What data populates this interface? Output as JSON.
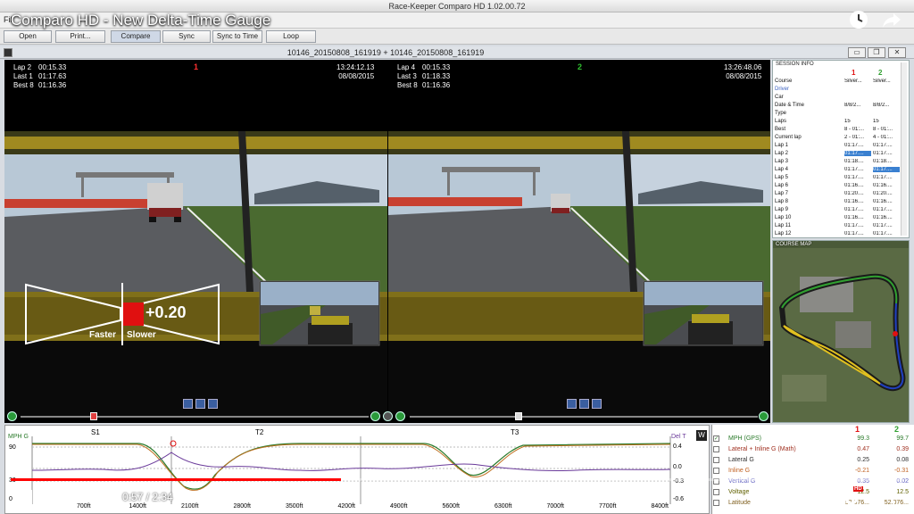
{
  "app": {
    "title": "Race-Keeper Comparo HD 1.02.00.72",
    "menu": [
      "Fil"
    ],
    "toolbar": [
      "Open",
      "Print...",
      "Compare",
      "Sync",
      "Sync to Time",
      "Loop"
    ]
  },
  "youtube": {
    "video_title": "Comparo HD - New Delta-Time Gauge",
    "current_time": "0:57",
    "total_time": "2:34",
    "progress": 0.37,
    "hd_badge": "HD"
  },
  "session": {
    "title": "10146_20150808_161919 + 10146_20150808_161919"
  },
  "video1": {
    "marker": "1",
    "rows": [
      {
        "label": "Lap 2",
        "value": "00:15.33"
      },
      {
        "label": "Last 1",
        "value": "01:17.63"
      },
      {
        "label": "Best 8",
        "value": "01:16.36"
      }
    ],
    "clock": "13:24:12.13",
    "date": "08/08/2015"
  },
  "video2": {
    "marker": "2",
    "rows": [
      {
        "label": "Lap 4",
        "value": "00:15.33"
      },
      {
        "label": "Last 3",
        "value": "01:18.33"
      },
      {
        "label": "Best 8",
        "value": "01:16.36"
      }
    ],
    "clock": "13:26:48.06",
    "date": "08/08/2015"
  },
  "gauge": {
    "delta": "+0.20",
    "faster_label": "Faster",
    "slower_label": "Slower"
  },
  "session_info": {
    "title": "SESSION INFO",
    "col1": "1",
    "col2": "2",
    "rows": [
      {
        "label": "Course",
        "v1": "Silver...",
        "v2": "Silver..."
      },
      {
        "label": "Driver",
        "v1": "",
        "v2": ""
      },
      {
        "label": "Car",
        "v1": "",
        "v2": ""
      },
      {
        "label": "Date & Time",
        "v1": "8/8/2...",
        "v2": "8/8/2..."
      },
      {
        "label": "Type",
        "v1": "",
        "v2": ""
      },
      {
        "label": "Laps",
        "v1": "15",
        "v2": "15"
      },
      {
        "label": "Best",
        "v1": "8 - 01:...",
        "v2": "8 - 01:..."
      },
      {
        "label": "Current lap",
        "v1": "2 - 01:...",
        "v2": "4 - 01:..."
      },
      {
        "label": "Lap 1",
        "v1": "01:17....",
        "v2": "01:17...."
      },
      {
        "label": "Lap 2",
        "v1": "01:17....",
        "v2": "01:17...."
      },
      {
        "label": "Lap 3",
        "v1": "01:18....",
        "v2": "01:18...."
      },
      {
        "label": "Lap 4",
        "v1": "01:17....",
        "v2": "01:17...."
      },
      {
        "label": "Lap 5",
        "v1": "01:17....",
        "v2": "01:17...."
      },
      {
        "label": "Lap 6",
        "v1": "01:16....",
        "v2": "01:16...."
      },
      {
        "label": "Lap 7",
        "v1": "01:20....",
        "v2": "01:20...."
      },
      {
        "label": "Lap 8",
        "v1": "01:16....",
        "v2": "01:16...."
      },
      {
        "label": "Lap 9",
        "v1": "01:17....",
        "v2": "01:17...."
      },
      {
        "label": "Lap 10",
        "v1": "01:16....",
        "v2": "01:16...."
      },
      {
        "label": "Lap 11",
        "v1": "01:17....",
        "v2": "01:17...."
      },
      {
        "label": "Lap 12",
        "v1": "01:17....",
        "v2": "01:17...."
      }
    ]
  },
  "course_map": {
    "title": "COURSE MAP"
  },
  "telemetry": {
    "left_axis_label": "MPH G",
    "right_axis_label": "Del T",
    "w_button": "W",
    "sectors": [
      "S1",
      "T2",
      "T3"
    ],
    "left_ticks": [
      "90",
      "30",
      "0"
    ],
    "right_ticks": [
      "0.4",
      "0.0",
      "-0.3",
      "-0.6"
    ],
    "x_ticks": [
      "700ft",
      "1400ft",
      "2100ft",
      "2800ft",
      "3500ft",
      "4200ft",
      "4900ft",
      "5600ft",
      "6300ft",
      "7000ft",
      "7700ft",
      "8400ft"
    ]
  },
  "readouts": {
    "col1": "1",
    "col2": "2",
    "rows": [
      {
        "name": "MPH (GPS)",
        "a": "99.3",
        "b": "99.7",
        "checked": true,
        "color": "#2a7a2a"
      },
      {
        "name": "Lateral + Inline G (Math)",
        "a": "0.47",
        "b": "0.39",
        "checked": false,
        "color": "#a03020"
      },
      {
        "name": "Lateral G",
        "a": "0.25",
        "b": "0.08",
        "checked": false,
        "color": "#303030"
      },
      {
        "name": "Inline G",
        "a": "-0.21",
        "b": "-0.31",
        "checked": false,
        "color": "#c06020"
      },
      {
        "name": "Vertical G",
        "a": "0.35",
        "b": "0.02",
        "checked": false,
        "color": "#6060c0"
      },
      {
        "name": "Voltage",
        "a": "12.5",
        "b": "12.5",
        "checked": false,
        "color": "#606000"
      },
      {
        "name": "Latitude",
        "a": "52.076...",
        "b": "52.076...",
        "checked": false,
        "color": "#806020"
      }
    ]
  },
  "colors": {
    "accent_red": "#e01010",
    "marker_green": "#30c030",
    "select_blue": "#3a80d0"
  }
}
